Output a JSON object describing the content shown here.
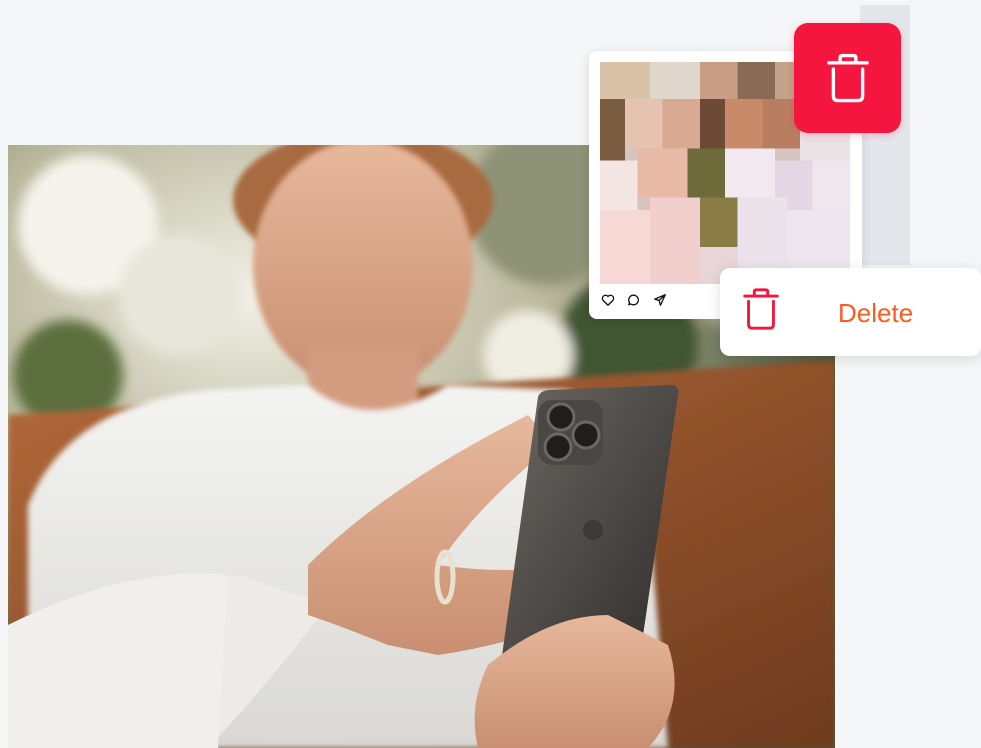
{
  "delete_menu": {
    "label": "Delete",
    "label_color": "#ff5a1f",
    "icon": "trash-icon",
    "icon_color": "#f4163f"
  },
  "trash_badge": {
    "icon": "trash-icon",
    "background_color": "#f4163f"
  },
  "post_card": {
    "image": "pixelated-photo",
    "actions": [
      {
        "icon": "heart-icon"
      },
      {
        "icon": "comment-icon"
      },
      {
        "icon": "send-icon"
      }
    ]
  },
  "hero_photo": {
    "description_icon": "woman-with-phone-photo"
  }
}
